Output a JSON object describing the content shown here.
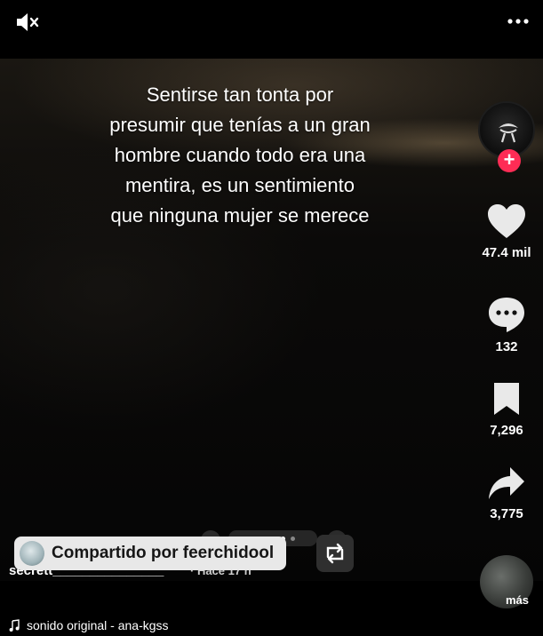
{
  "video": {
    "caption": "Sentirse tan tonta por\npresumir que tenías a un gran\nhombre cuando todo era una\nmentira, es un sentimiento\nque ninguna mujer se merece"
  },
  "controls": {
    "mute_icon": "muted-speaker-icon",
    "more_icon": "more-dots-icon"
  },
  "actions": {
    "follow_label": "+",
    "likes": "47.4 mil",
    "comments": "132",
    "saves": "7,296",
    "shares": "3,775"
  },
  "shared": {
    "label": "Compartido por feerchidool"
  },
  "post": {
    "author": "secrett_______________",
    "time": "· Hace 17 h",
    "more_label": "más",
    "sound_icon": "music-note-icon",
    "sound": "sonido original - ana-kgss"
  },
  "colors": {
    "accent": "#fe2c55",
    "background": "#000000",
    "pill": "#e8e8e8"
  },
  "carousel": {
    "dots": 5,
    "active_dot": 4
  }
}
